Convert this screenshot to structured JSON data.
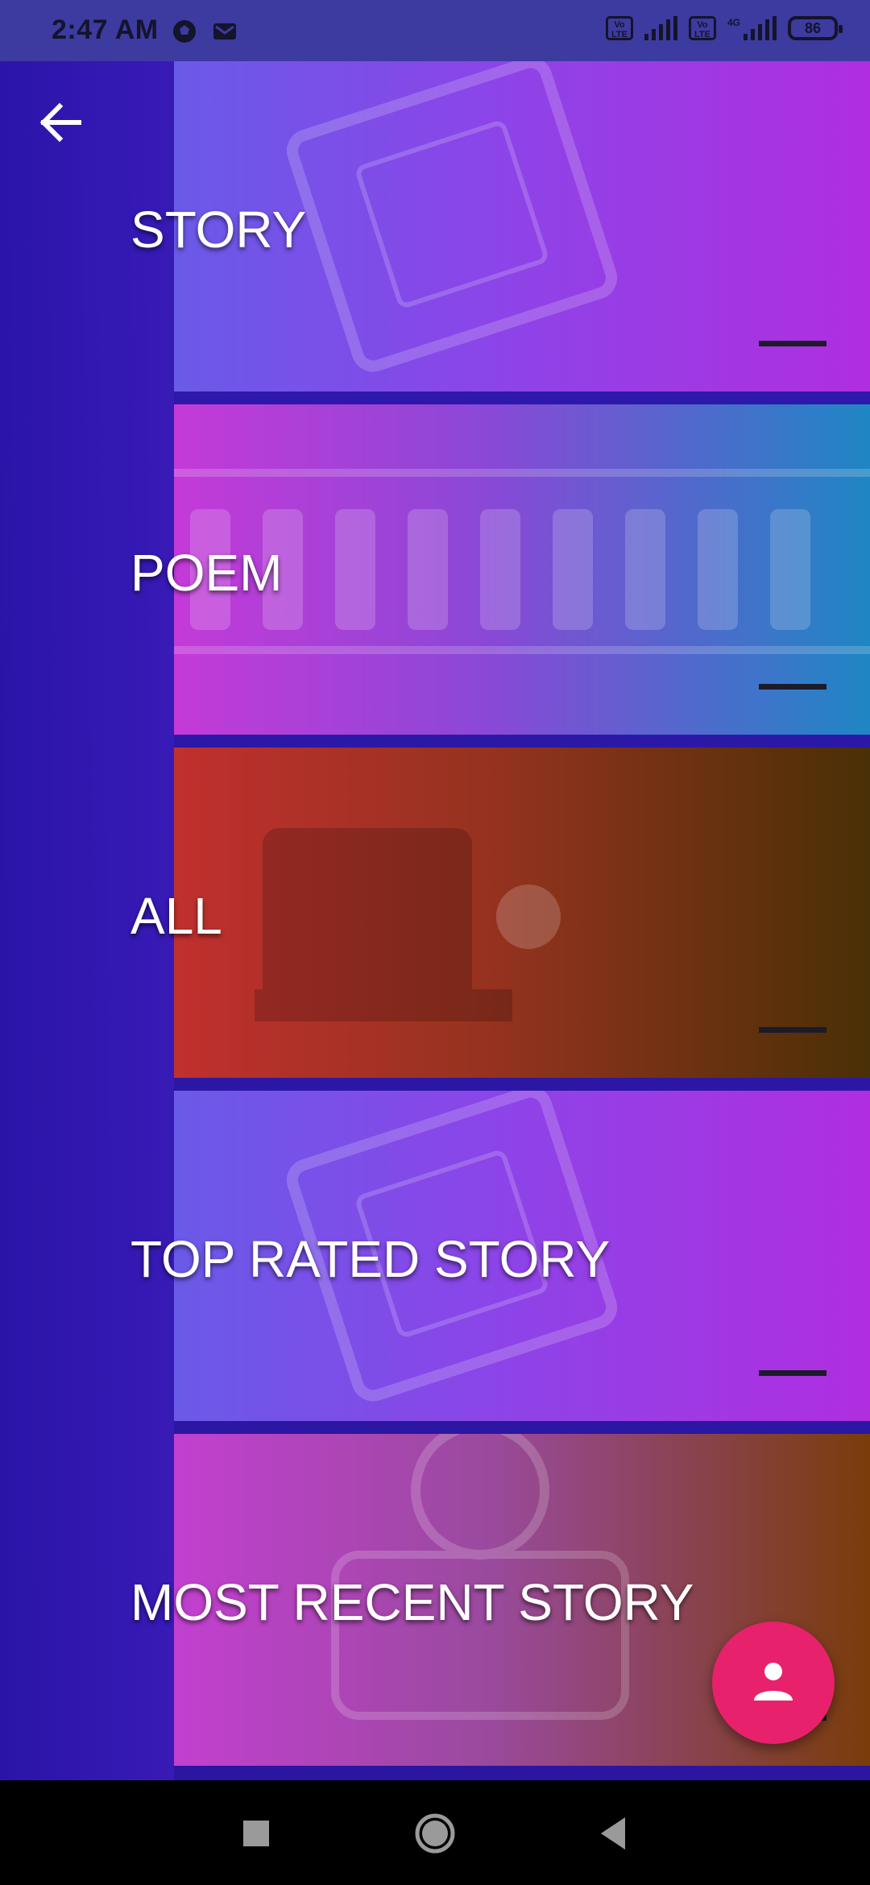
{
  "status_bar": {
    "time": "2:47 AM",
    "network1_label": "Vo LTE",
    "network2_label": "Vo LTE",
    "network2_tech": "4G",
    "battery_level": "86"
  },
  "drawer": {
    "back_icon": "arrow-left-icon",
    "categories": [
      {
        "label": "STORY"
      },
      {
        "label": "POEM"
      },
      {
        "label": "ALL"
      },
      {
        "label": "TOP RATED STORY"
      },
      {
        "label": "MOST RECENT STORY"
      }
    ]
  },
  "fab": {
    "icon": "person-icon",
    "color": "#e8216c"
  },
  "nav_bar": {
    "recents_icon": "square-icon",
    "home_icon": "circle-icon",
    "back_icon": "triangle-back-icon"
  }
}
